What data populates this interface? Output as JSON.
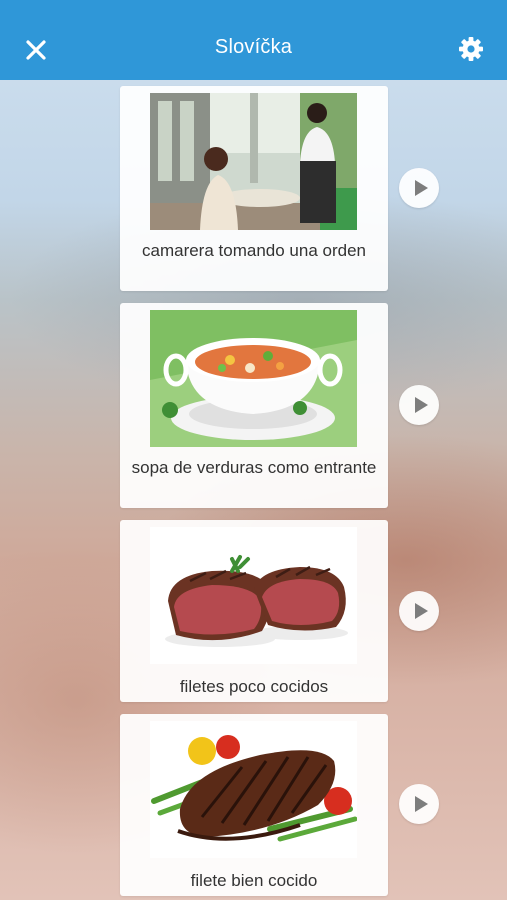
{
  "header": {
    "title": "Slovíčka",
    "close_icon": "close-icon",
    "settings_icon": "gear-icon",
    "background_color": "#2f97d8"
  },
  "cards": [
    {
      "caption": "camarera tomando una orden",
      "image": "waitress-taking-order-photo",
      "play_icon": "play-icon"
    },
    {
      "caption": "sopa de verduras como entrante",
      "image": "vegetable-soup-photo",
      "play_icon": "play-icon"
    },
    {
      "caption": "filetes poco cocidos",
      "image": "rare-steaks-photo",
      "play_icon": "play-icon"
    },
    {
      "caption": "filete bien cocido",
      "image": "well-done-steak-photo",
      "play_icon": "play-icon"
    }
  ]
}
